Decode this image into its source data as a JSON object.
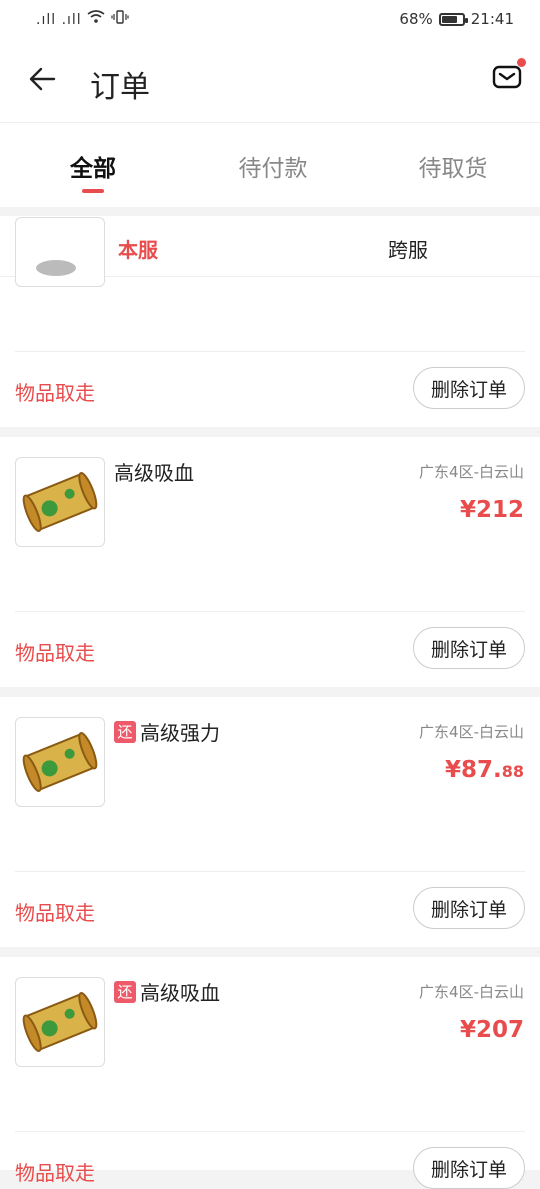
{
  "status_bar": {
    "signal": ".ıll .ıll",
    "battery_text": "68%",
    "battery_level": 0.68,
    "time": "21:41"
  },
  "header": {
    "title": "订单"
  },
  "tabs": [
    {
      "label": "全部",
      "active": true
    },
    {
      "label": "待付款",
      "active": false
    },
    {
      "label": "待取货",
      "active": false
    }
  ],
  "subtabs": [
    {
      "label": "本服",
      "active": true
    },
    {
      "label": "跨服",
      "active": false
    }
  ],
  "orders": [
    {
      "status": "物品取走",
      "delete_label": "删除订单"
    },
    {
      "name": "高级吸血",
      "tag": "",
      "server": "广东4区-白云山",
      "price_main": "¥212",
      "price_cents": "",
      "status": "物品取走",
      "delete_label": "删除订单"
    },
    {
      "name": "高级强力",
      "tag": "还",
      "server": "广东4区-白云山",
      "price_main": "¥87.",
      "price_cents": "88",
      "status": "物品取走",
      "delete_label": "删除订单"
    },
    {
      "name": "高级吸血",
      "tag": "还",
      "server": "广东4区-白云山",
      "price_main": "¥207",
      "price_cents": "",
      "status": "物品取走",
      "delete_label": "删除订单"
    }
  ],
  "colors": {
    "accent": "#e84c4c",
    "tag": "#ee5a6a"
  }
}
